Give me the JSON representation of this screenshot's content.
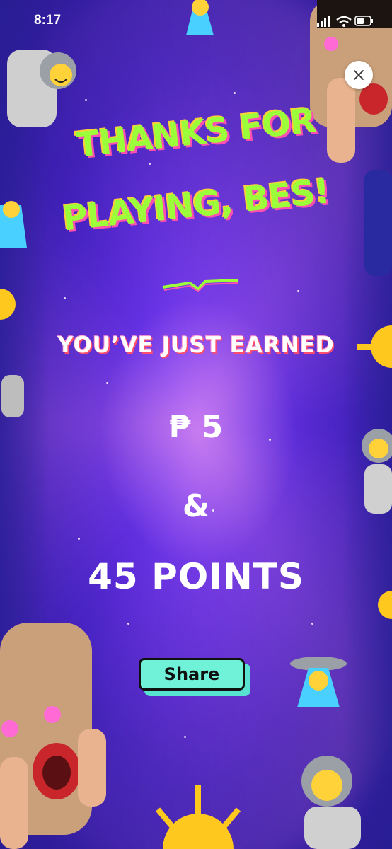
{
  "status": {
    "time": "8:17"
  },
  "title": {
    "line1": "THANKS FOR",
    "line2": "PLAYING,",
    "name": "BES!"
  },
  "earned_label": "YOU’VE JUST EARNED",
  "reward": {
    "peso": "₱ 5",
    "amp": "&",
    "points": "45 POINTS"
  },
  "share_label": "Share",
  "colors": {
    "title_green": "#9bff3a",
    "title_shadow_pink": "#ff4fb0",
    "share_bg": "#6ff2d8",
    "background_purple": "#5a2bd8"
  },
  "icons": [
    "close-icon",
    "signal-icon",
    "wifi-icon",
    "battery-icon"
  ]
}
